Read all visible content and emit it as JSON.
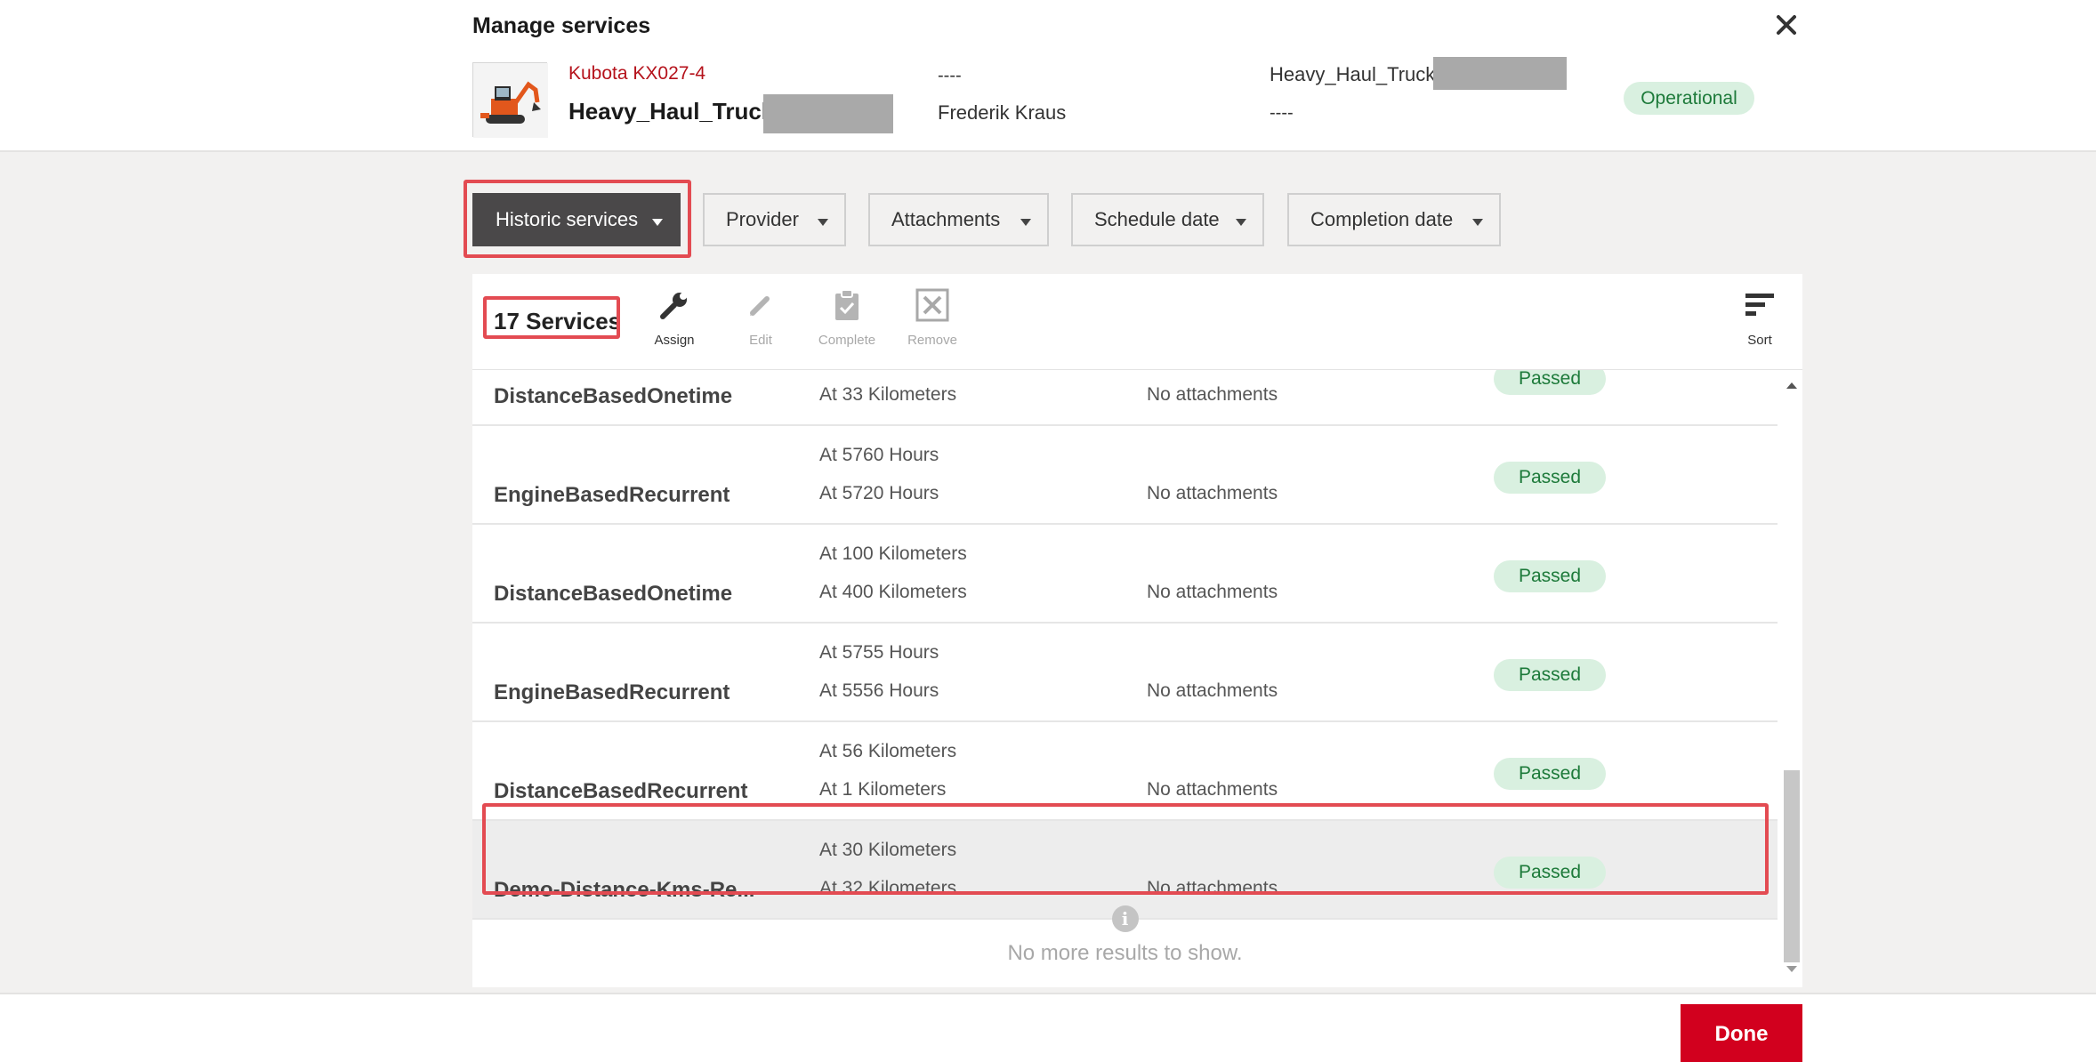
{
  "dialog": {
    "title": "Manage services",
    "close_icon": "close-icon"
  },
  "asset": {
    "model": "Kubota KX027-4",
    "name": "Heavy_Haul_Truck",
    "field_a": "----",
    "operator": "Frederik Kraus",
    "group": "Heavy_Haul_Truck",
    "field_b": "----",
    "status": "Operational"
  },
  "filters": [
    {
      "label": "Historic services",
      "active": true
    },
    {
      "label": "Provider"
    },
    {
      "label": "Attachments"
    },
    {
      "label": "Schedule date"
    },
    {
      "label": "Completion date"
    }
  ],
  "toolbar": {
    "count": "17 Services",
    "assign": "Assign",
    "edit": "Edit",
    "complete": "Complete",
    "remove": "Remove",
    "sort": "Sort"
  },
  "services": [
    {
      "name": "DistanceBasedOnetime",
      "v1": "",
      "v2": "At 33 Kilometers",
      "attachments": "No attachments",
      "status": "Passed"
    },
    {
      "name": "EngineBasedRecurrent",
      "v1": "At 5760 Hours",
      "v2": "At 5720 Hours",
      "attachments": "No attachments",
      "status": "Passed"
    },
    {
      "name": "DistanceBasedOnetime",
      "v1": "At 100 Kilometers",
      "v2": "At 400 Kilometers",
      "attachments": "No attachments",
      "status": "Passed"
    },
    {
      "name": "EngineBasedRecurrent",
      "v1": "At 5755 Hours",
      "v2": "At 5556 Hours",
      "attachments": "No attachments",
      "status": "Passed"
    },
    {
      "name": "DistanceBasedRecurrent",
      "v1": "At 56 Kilometers",
      "v2": "At 1 Kilometers",
      "attachments": "No attachments",
      "status": "Passed"
    },
    {
      "name": "Demo-Distance-Kms-Re...",
      "v1": "At 30 Kilometers",
      "v2": "At 32 Kilometers",
      "attachments": "No attachments",
      "status": "Passed",
      "selected": true
    }
  ],
  "end_message": "No more results to show.",
  "footer": {
    "done": "Done"
  },
  "colors": {
    "accent_red": "#d2001e",
    "brand_red_text": "#b5121b",
    "status_green_bg": "#d9f0e0",
    "status_green_text": "#1d7a3a",
    "highlight": "#e34b52",
    "active_filter": "#4a4849"
  }
}
